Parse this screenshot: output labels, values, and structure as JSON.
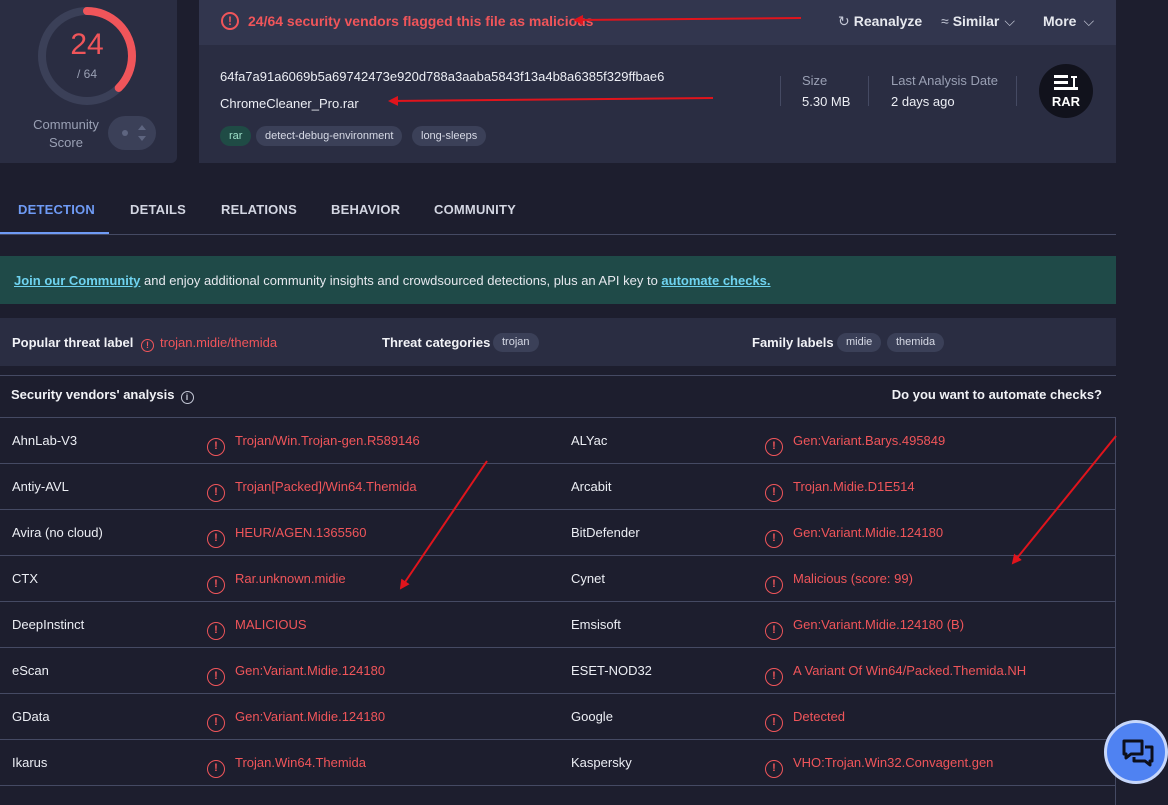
{
  "score": {
    "detections": "24",
    "total": "/ 64",
    "community_label": "Community Score",
    "fraction": 0.375
  },
  "alert": {
    "text": "24/64 security vendors flagged this file as malicious"
  },
  "header_buttons": {
    "reanalyze": "Reanalyze",
    "similar": "Similar",
    "more": "More"
  },
  "file": {
    "hash": "64fa7a91a6069b5a69742473e920d788a3aaba5843f13a4b8a6385f329ffbae6",
    "name": "ChromeCleaner_Pro.rar",
    "tags": [
      "rar",
      "detect-debug-environment",
      "long-sleeps"
    ],
    "size_label": "Size",
    "size_value": "5.30 MB",
    "last_analysis_label": "Last Analysis Date",
    "last_analysis_value": "2 days ago",
    "type_badge": "RAR"
  },
  "tabs": [
    "DETECTION",
    "DETAILS",
    "RELATIONS",
    "BEHAVIOR",
    "COMMUNITY"
  ],
  "banner": {
    "link1": "Join our Community",
    "middle": " and enjoy additional community insights and crowdsourced detections, plus an API key to ",
    "link2": "automate checks."
  },
  "threat": {
    "popular_label": "Popular threat label",
    "popular_value": "trojan.midie/themida",
    "categories_label": "Threat categories",
    "categories": [
      "trojan"
    ],
    "family_label": "Family labels",
    "families": [
      "midie",
      "themida"
    ]
  },
  "vendors": {
    "title": "Security vendors' analysis",
    "automate": "Do you want to automate checks?",
    "rows": [
      {
        "left_name": "AhnLab-V3",
        "left_result": "Trojan/Win.Trojan-gen.R589146",
        "right_name": "ALYac",
        "right_result": "Gen:Variant.Barys.495849"
      },
      {
        "left_name": "Antiy-AVL",
        "left_result": "Trojan[Packed]/Win64.Themida",
        "right_name": "Arcabit",
        "right_result": "Trojan.Midie.D1E514"
      },
      {
        "left_name": "Avira (no cloud)",
        "left_result": "HEUR/AGEN.1365560",
        "right_name": "BitDefender",
        "right_result": "Gen:Variant.Midie.124180"
      },
      {
        "left_name": "CTX",
        "left_result": "Rar.unknown.midie",
        "right_name": "Cynet",
        "right_result": "Malicious (score: 99)"
      },
      {
        "left_name": "DeepInstinct",
        "left_result": "MALICIOUS",
        "right_name": "Emsisoft",
        "right_result": "Gen:Variant.Midie.124180 (B)"
      },
      {
        "left_name": "eScan",
        "left_result": "Gen:Variant.Midie.124180",
        "right_name": "ESET-NOD32",
        "right_result": "A Variant Of Win64/Packed.Themida.NH"
      },
      {
        "left_name": "GData",
        "left_result": "Gen:Variant.Midie.124180",
        "right_name": "Google",
        "right_result": "Detected"
      },
      {
        "left_name": "Ikarus",
        "left_result": "Trojan.Win64.Themida",
        "right_name": "Kaspersky",
        "right_result": "VHO:Trojan.Win32.Convagent.gen"
      }
    ]
  },
  "colors": {
    "malicious": "#f0555a",
    "accent": "#6f9bf5",
    "arrow": "#e0141c",
    "chat": "#4f82f2"
  }
}
